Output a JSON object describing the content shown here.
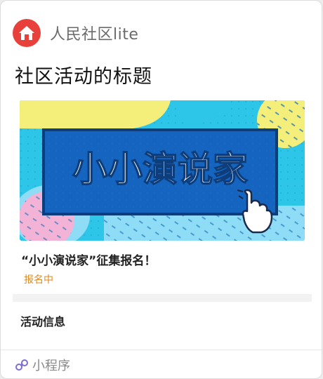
{
  "app": {
    "name": "人民社区lite",
    "logo_icon": "home-icon",
    "brand_color": "#e8413c"
  },
  "share": {
    "title": "社区活动的标题"
  },
  "banner": {
    "text": "小小演说家",
    "pointer_icon": "hand-pointer-icon",
    "colors": {
      "background": "#2ec6e8",
      "panel": "#1565c0",
      "yellow": "#f3ef7a",
      "pink": "#f3b3d6",
      "light_blue": "#8edcf5"
    }
  },
  "event": {
    "title": "“小小演说家”征集报名！",
    "status": "报名中",
    "status_color": "#e08a1e"
  },
  "section": {
    "title": "活动信息"
  },
  "footer": {
    "icon": "mini-program-icon",
    "label": "小程序"
  }
}
